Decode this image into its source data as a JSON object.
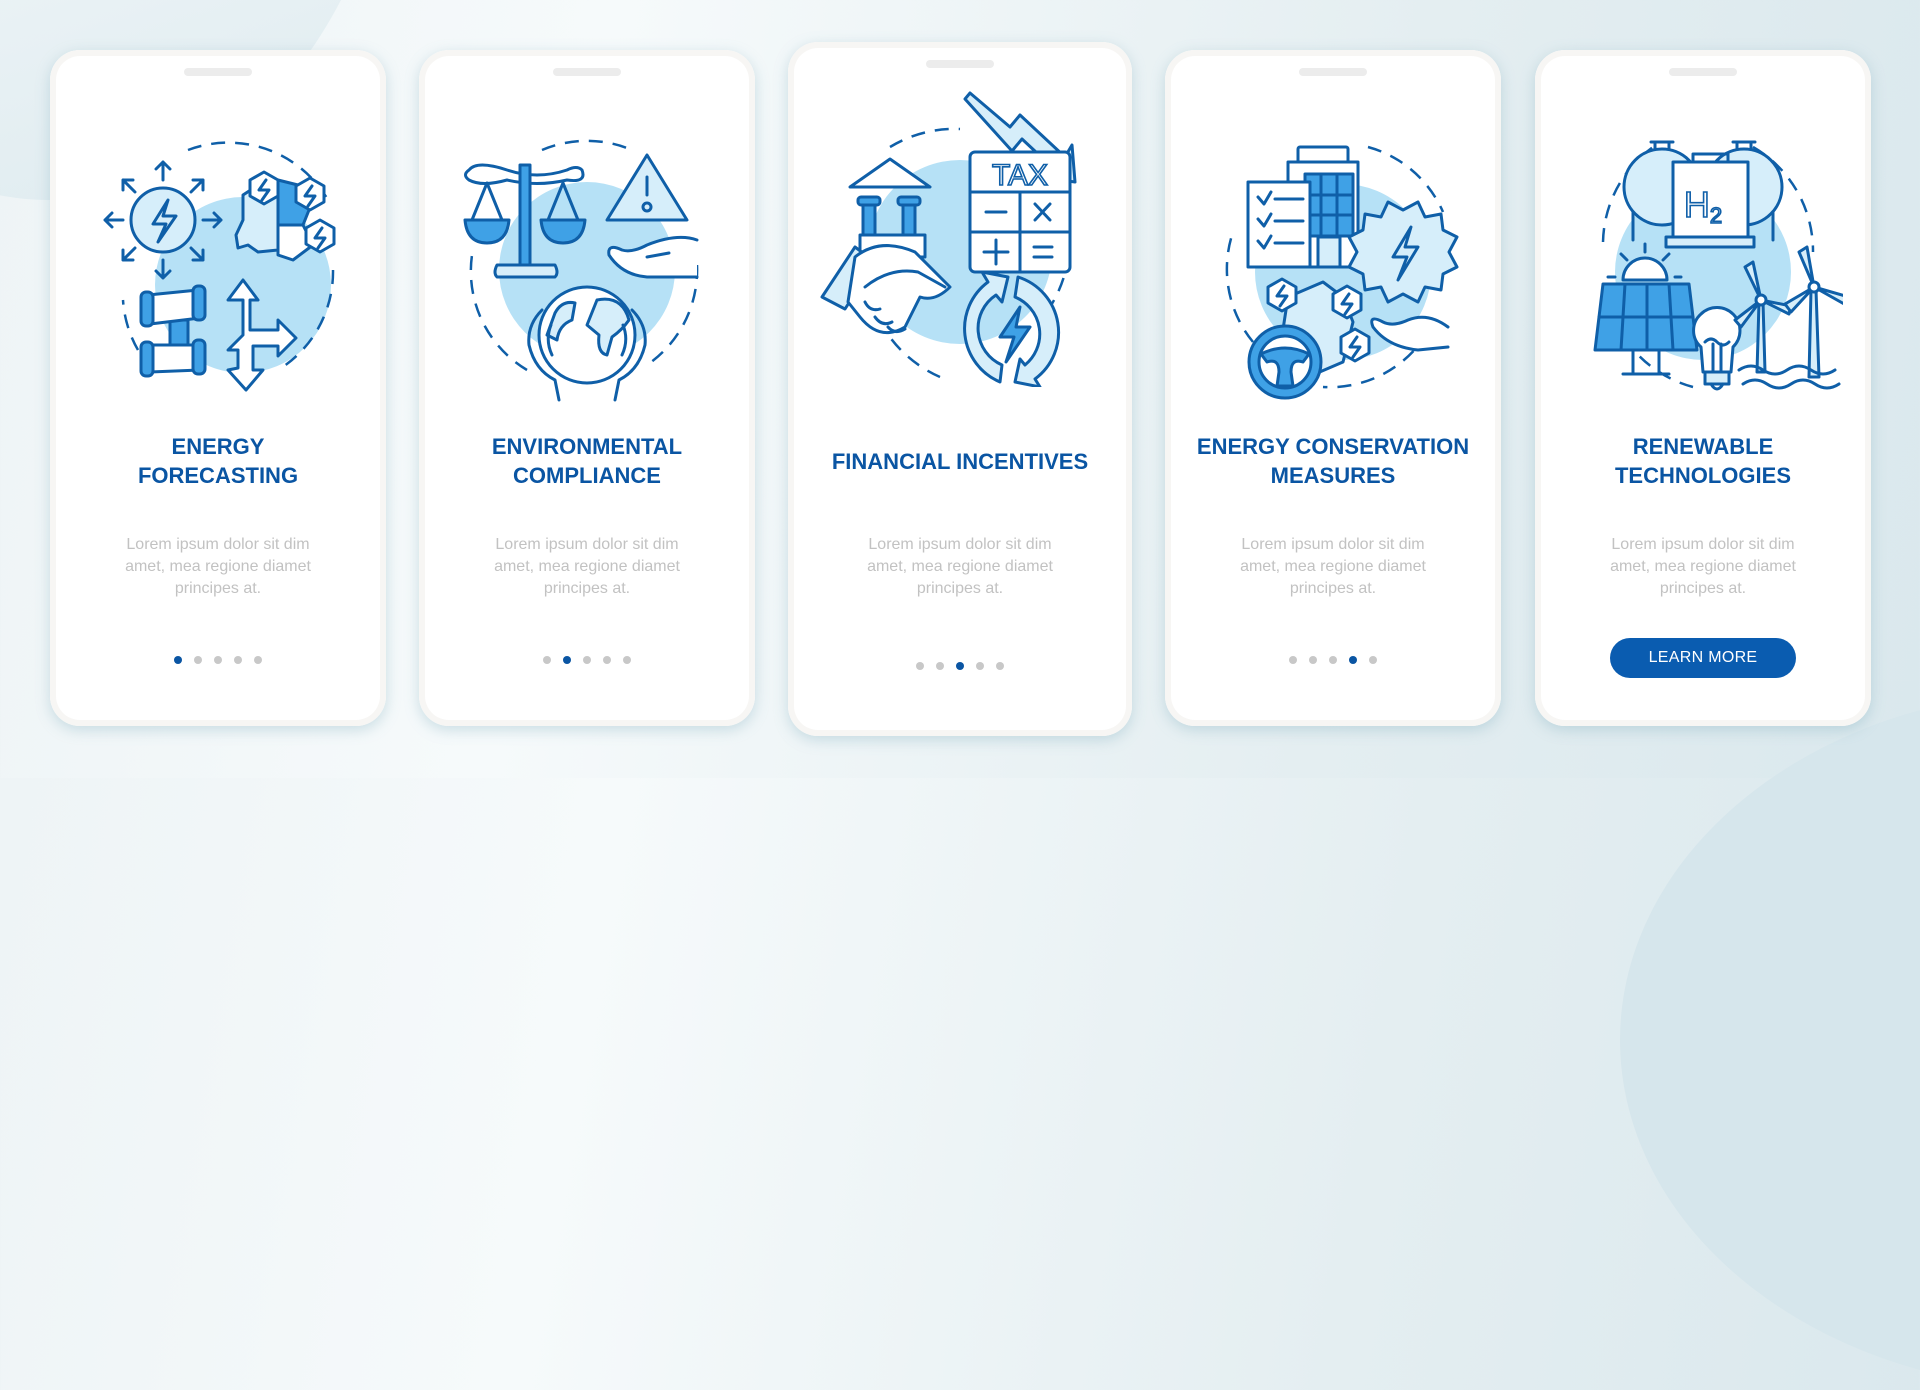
{
  "cards": [
    {
      "title_lines": [
        "ENERGY",
        "FORECASTING"
      ],
      "description_lines": [
        "Lorem ipsum dolor sit dim",
        "amet, mea regione diamet",
        "principes at."
      ],
      "illustration": "energy-forecasting-illustration",
      "active_page": 1,
      "total_pages": 5
    },
    {
      "title_lines": [
        "ENVIRONMENTAL",
        "COMPLIANCE"
      ],
      "description_lines": [
        "Lorem ipsum dolor sit dim",
        "amet, mea regione diamet",
        "principes at."
      ],
      "illustration": "environmental-compliance-illustration",
      "active_page": 2,
      "total_pages": 5
    },
    {
      "title_lines": [
        "FINANCIAL INCENTIVES"
      ],
      "description_lines": [
        "Lorem ipsum dolor sit dim",
        "amet, mea regione diamet",
        "principes at."
      ],
      "illustration": "financial-incentives-illustration",
      "tax_label": "TAX",
      "active_page": 3,
      "total_pages": 5
    },
    {
      "title_lines": [
        "ENERGY CONSERVATION",
        "MEASURES"
      ],
      "description_lines": [
        "Lorem ipsum dolor sit dim",
        "amet, mea regione diamet",
        "principes at."
      ],
      "illustration": "energy-conservation-illustration",
      "active_page": 4,
      "total_pages": 5
    },
    {
      "title_lines": [
        "RENEWABLE",
        "TECHNOLOGIES"
      ],
      "description_lines": [
        "Lorem ipsum dolor sit dim",
        "amet, mea regione diamet",
        "principes at."
      ],
      "illustration": "renewable-technologies-illustration",
      "h2_label": "H",
      "h2_sub": "2",
      "button_label": "LEARN MORE"
    }
  ],
  "colors": {
    "accent": "#0a55a3",
    "button": "#0a5cb0",
    "illustration_fill": "#3fa1e6",
    "illustration_bg": "#b6e1f6",
    "dot_inactive": "#c8c8c8",
    "description": "#c2c2c2"
  }
}
